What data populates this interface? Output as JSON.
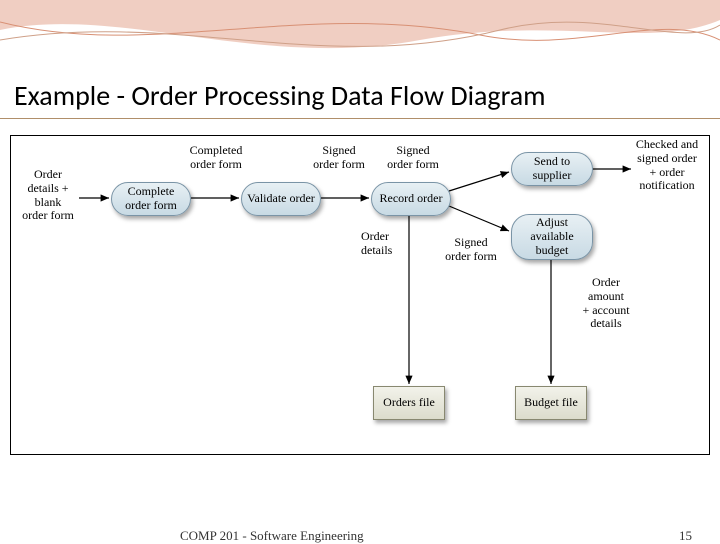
{
  "slide": {
    "title": "Example - Order Processing Data Flow Diagram",
    "footer_text": "COMP 201 - Software Engineering",
    "page_number": "15"
  },
  "diagram": {
    "processes": {
      "complete_order_form": "Complete\norder form",
      "validate_order": "Validate\norder",
      "record_order": "Record\norder",
      "send_to_supplier": "Send to\nsupplier",
      "adjust_available_budget": "Adjust\navailable\nbudget"
    },
    "files": {
      "orders_file": "Orders\nfile",
      "budget_file": "Budget\nfile"
    },
    "labels": {
      "input": "Order\ndetails +\nblank\norder form",
      "completed_order_form": "Completed\norder form",
      "signed_order_form_1": "Signed\norder form",
      "signed_order_form_2": "Signed\norder form",
      "order_details": "Order\ndetails",
      "signed_order_form_3": "Signed\norder form",
      "output_top": "Checked and\nsigned order\n+ order\nnotification",
      "order_amount": "Order\namount\n+ account\ndetails"
    }
  }
}
